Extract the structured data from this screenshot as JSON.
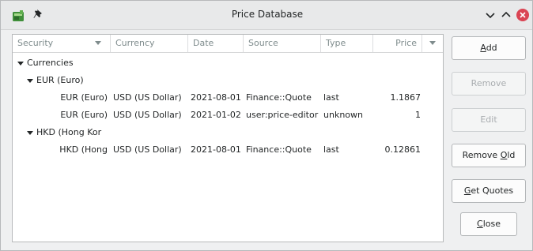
{
  "window": {
    "title": "Price Database",
    "icons": {
      "app": "gnucash-app-icon",
      "pin": "pin-icon",
      "minimize": "chevron-down-icon",
      "maximize": "chevron-up-icon",
      "close": "close-icon"
    },
    "colors": {
      "close_button": "#da4453",
      "selection_accent": "#3daee9"
    }
  },
  "table": {
    "columns": [
      "Security",
      "Currency",
      "Date",
      "Source",
      "Type",
      "Price"
    ],
    "rows": [
      {
        "level": 0,
        "expanded": true,
        "security": "Currencies",
        "currency": "",
        "date": "",
        "source": "",
        "type": "",
        "price": ""
      },
      {
        "level": 1,
        "expanded": true,
        "security": "EUR (Euro)",
        "currency": "",
        "date": "",
        "source": "",
        "type": "",
        "price": ""
      },
      {
        "level": 2,
        "expanded": false,
        "security": "EUR (Euro)",
        "currency": "USD (US Dollar)",
        "date": "2021-08-01",
        "source": "Finance::Quote",
        "type": "last",
        "price": "1.1867"
      },
      {
        "level": 2,
        "expanded": false,
        "security": "EUR (Euro)",
        "currency": "USD (US Dollar)",
        "date": "2021-01-02",
        "source": "user:price-editor",
        "type": "unknown",
        "price": "1"
      },
      {
        "level": 1,
        "expanded": true,
        "security": "HKD (Hong Kor",
        "currency": "",
        "date": "",
        "source": "",
        "type": "",
        "price": ""
      },
      {
        "level": 2,
        "expanded": false,
        "security": "HKD (Hong",
        "currency": "USD (US Dollar)",
        "date": "2021-08-01",
        "source": "Finance::Quote",
        "type": "last",
        "price": "0.12861"
      }
    ]
  },
  "buttons": {
    "add": {
      "label": "Add",
      "mnemonic": "A",
      "rest": "dd",
      "enabled": true
    },
    "remove": {
      "label": "Remove",
      "enabled": false
    },
    "edit": {
      "label": "Edit",
      "enabled": false
    },
    "remove_old": {
      "label": "Remove Old",
      "pre": "Remove ",
      "mnemonic": "O",
      "rest": "ld",
      "enabled": true
    },
    "get_quotes": {
      "label": "Get Quotes",
      "mnemonic": "G",
      "rest": "et Quotes",
      "enabled": true
    },
    "close": {
      "label": "Close",
      "mnemonic": "C",
      "rest": "lose",
      "enabled": true
    }
  }
}
